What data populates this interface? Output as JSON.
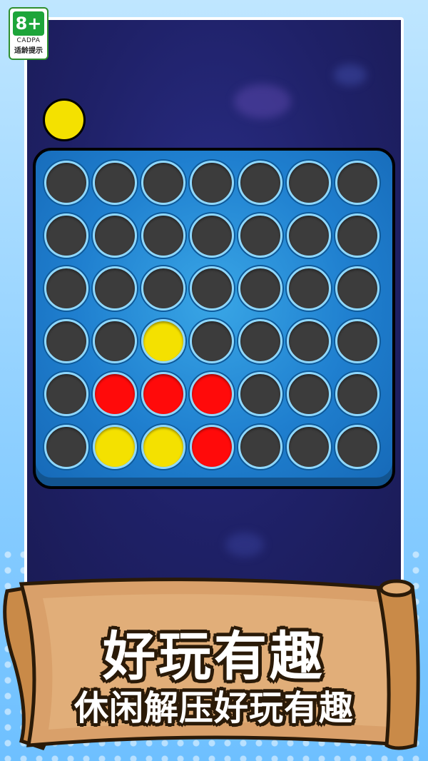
{
  "age_rating": {
    "value": "8+",
    "org": "CADPA",
    "hint": "适龄提示"
  },
  "colors": {
    "yellow": "#f4e100",
    "red": "#ff0a0a",
    "empty": "#3c3c3c",
    "board": "#1f7fcf"
  },
  "current_disc": "yellow",
  "board": {
    "rows": [
      [
        "empty",
        "empty",
        "empty",
        "empty",
        "empty",
        "empty",
        "empty"
      ],
      [
        "empty",
        "empty",
        "empty",
        "empty",
        "empty",
        "empty",
        "empty"
      ],
      [
        "empty",
        "empty",
        "empty",
        "empty",
        "empty",
        "empty",
        "empty"
      ],
      [
        "empty",
        "empty",
        "yellow",
        "empty",
        "empty",
        "empty",
        "empty"
      ],
      [
        "empty",
        "red",
        "red",
        "red",
        "empty",
        "empty",
        "empty"
      ],
      [
        "empty",
        "yellow",
        "yellow",
        "red",
        "empty",
        "empty",
        "empty"
      ]
    ]
  },
  "banner": {
    "title": "好玩有趣",
    "subtitle": "休闲解压好玩有趣"
  }
}
